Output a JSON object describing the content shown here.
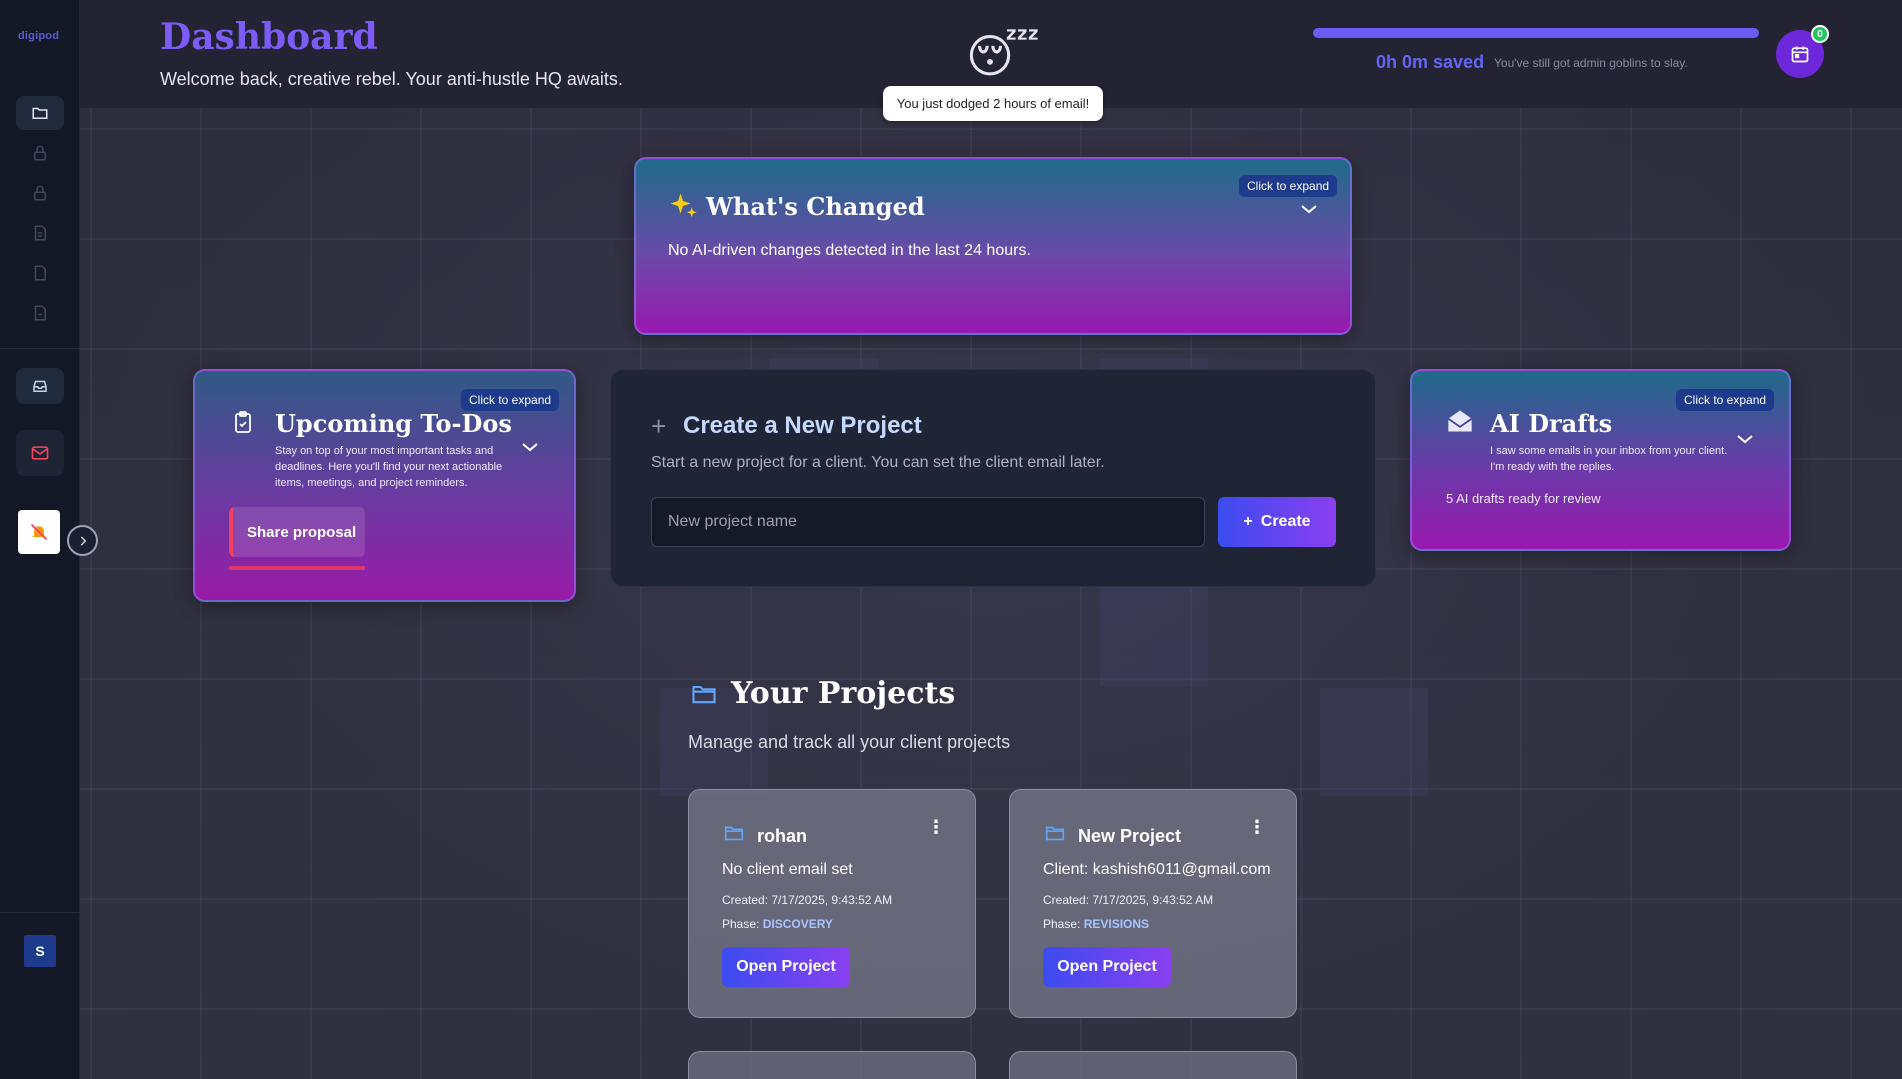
{
  "app": {
    "logo": "digipod"
  },
  "header": {
    "title": "Dashboard",
    "subtitle": "Welcome back, creative rebel. Your anti-hustle HQ awaits.",
    "emoji": "😴",
    "toast": "You just dodged 2 hours of email!",
    "progress": 1.0,
    "saved": "0h 0m saved",
    "saved_note": "You've still got admin goblins to slay.",
    "calendar_badge": "0"
  },
  "sidebar": {
    "items": [
      {
        "icon": "folder-icon",
        "active": true
      },
      {
        "icon": "lock-icon",
        "active": false
      },
      {
        "icon": "lock-icon",
        "active": false
      },
      {
        "icon": "document-icon",
        "active": false
      },
      {
        "icon": "document-icon",
        "active": false
      },
      {
        "icon": "document-icon",
        "active": false
      },
      {
        "icon": "inbox-icon",
        "active": true
      }
    ],
    "avatar": "S"
  },
  "whats_changed": {
    "title": "What's Changed",
    "expand": "Click to expand",
    "text": "No AI-driven changes detected in the last 24 hours."
  },
  "todos": {
    "title": "Upcoming To-Dos",
    "expand": "Click to expand",
    "description": "Stay on top of your most important tasks and deadlines. Here you'll find your next actionable items, meetings, and project reminders.",
    "items": [
      "Share proposal"
    ]
  },
  "create_project": {
    "title": "Create a New Project",
    "description": "Start a new project for a client. You can set the client email later.",
    "placeholder": "New project name",
    "button": "Create"
  },
  "ai_drafts": {
    "title": "AI Drafts",
    "expand": "Click to expand",
    "description": "I saw some emails in your inbox from your client. I'm ready with the replies.",
    "status": "5 AI drafts ready for review"
  },
  "projects": {
    "title": "Your Projects",
    "subtitle": "Manage and track all your client projects",
    "phase_label": "Phase:",
    "open_label": "Open Project",
    "items": [
      {
        "name": "rohan",
        "client": "No client email set",
        "created": "Created: 7/17/2025, 9:43:52 AM",
        "phase": "DISCOVERY"
      },
      {
        "name": "New Project",
        "client": "Client: kashish6011@gmail.com",
        "created": "Created: 7/17/2025, 9:43:52 AM",
        "phase": "REVISIONS"
      }
    ]
  },
  "colors": {
    "accent": "#7b5cf5",
    "brand_gradient_start": "#3b4cf0",
    "brand_gradient_end": "#8a3ff0",
    "alert": "#f43f5e"
  }
}
